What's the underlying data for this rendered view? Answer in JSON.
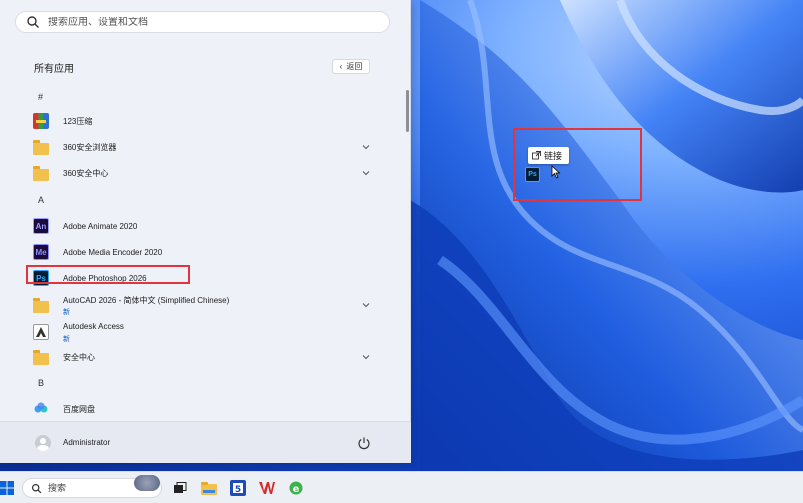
{
  "start_menu": {
    "search_placeholder": "搜索应用、设置和文档",
    "all_apps_title": "所有应用",
    "back_label": "返回",
    "sections": [
      {
        "letter": "#"
      },
      {
        "letter": "A"
      },
      {
        "letter": "B"
      }
    ],
    "apps": [
      {
        "label": "123压缩",
        "icon": "archive-icon",
        "sub": ""
      },
      {
        "label": "360安全浏览器",
        "icon": "folder-icon",
        "sub": "",
        "expandable": true
      },
      {
        "label": "360安全中心",
        "icon": "folder-icon",
        "sub": "",
        "expandable": true
      },
      {
        "label": "Adobe Animate 2020",
        "icon": "animate-icon",
        "icon_text": "An",
        "sub": ""
      },
      {
        "label": "Adobe Media Encoder 2020",
        "icon": "media-encoder-icon",
        "icon_text": "Me",
        "sub": ""
      },
      {
        "label": "Adobe Photoshop 2026",
        "icon": "photoshop-icon",
        "icon_text": "Ps",
        "sub": ""
      },
      {
        "label": "AutoCAD 2026 - 简体中文 (Simplified Chinese)",
        "icon": "folder-icon",
        "sub": "新",
        "expandable": true
      },
      {
        "label": "Autodesk Access",
        "icon": "autodesk-icon",
        "sub": "新"
      },
      {
        "label": "安全中心",
        "icon": "folder-icon",
        "sub": "",
        "expandable": true
      },
      {
        "label": "百度网盘",
        "icon": "baidu-netdisk-icon",
        "sub": ""
      }
    ],
    "user_name": "Administrator"
  },
  "desktop": {
    "drag_tooltip_label": "链接",
    "drag_icon_text": "Ps"
  },
  "taskbar": {
    "search_placeholder": "搜索"
  },
  "colors": {
    "highlight": "#e0353d",
    "photoshop_blue": "#31a8ff",
    "animate_purple": "#9a9fff",
    "media_encoder_purple": "#8d8dff"
  }
}
